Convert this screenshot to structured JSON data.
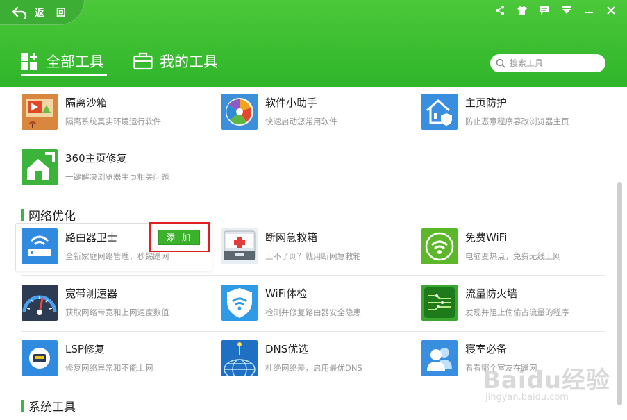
{
  "header": {
    "back_label": "返 回",
    "tabs": [
      {
        "label": "全部工具",
        "active": true
      },
      {
        "label": "我的工具",
        "active": false
      }
    ],
    "search_placeholder": "搜索工具"
  },
  "tools": {
    "isolation_sandbox": {
      "name": "隔离沙箱",
      "desc": "隔离系统真实环境运行软件"
    },
    "software_assistant": {
      "name": "软件小助手",
      "desc": "快速启动您常用软件"
    },
    "homepage_protect": {
      "name": "主页防护",
      "desc": "防止恶意程序篡改浏览器主页"
    },
    "homepage_repair": {
      "name": "360主页修复",
      "desc": "一键解决浏览器主页相关问题"
    },
    "router_guard": {
      "name": "路由器卫士",
      "desc": "全新家庭网络管理，秒踢蹭网"
    },
    "net_rescue": {
      "name": "断网急救箱",
      "desc": "上不了网？就用断网急救箱"
    },
    "free_wifi": {
      "name": "免费WiFi",
      "desc": "电脑变热点，免费无线上网"
    },
    "speed_test": {
      "name": "宽带测速器",
      "desc": "获取网络带宽和上网速度数值"
    },
    "wifi_check": {
      "name": "WiFi体检",
      "desc": "检测并修复路由器安全隐患"
    },
    "traffic_firewall": {
      "name": "流量防火墙",
      "desc": "发现并阻止偷偷占流量的程序"
    },
    "lsp_repair": {
      "name": "LSP修复",
      "desc": "修复网络异常和不能上网"
    },
    "dns_select": {
      "name": "DNS优选",
      "desc": "杜绝网络差，启用最优DNS"
    },
    "dorm_essential": {
      "name": "寝室必备",
      "desc": "看看哪个室友在蹭网"
    }
  },
  "sections": {
    "network": "网络优化",
    "system": "系统工具"
  },
  "add_button_label": "添加",
  "watermark": {
    "main": "Baidu经验",
    "sub": "jingyan.baidu.com"
  },
  "colors": {
    "header_green": "#3ab92f",
    "accent_green": "#3cb44a",
    "highlight_red": "#e02020"
  }
}
